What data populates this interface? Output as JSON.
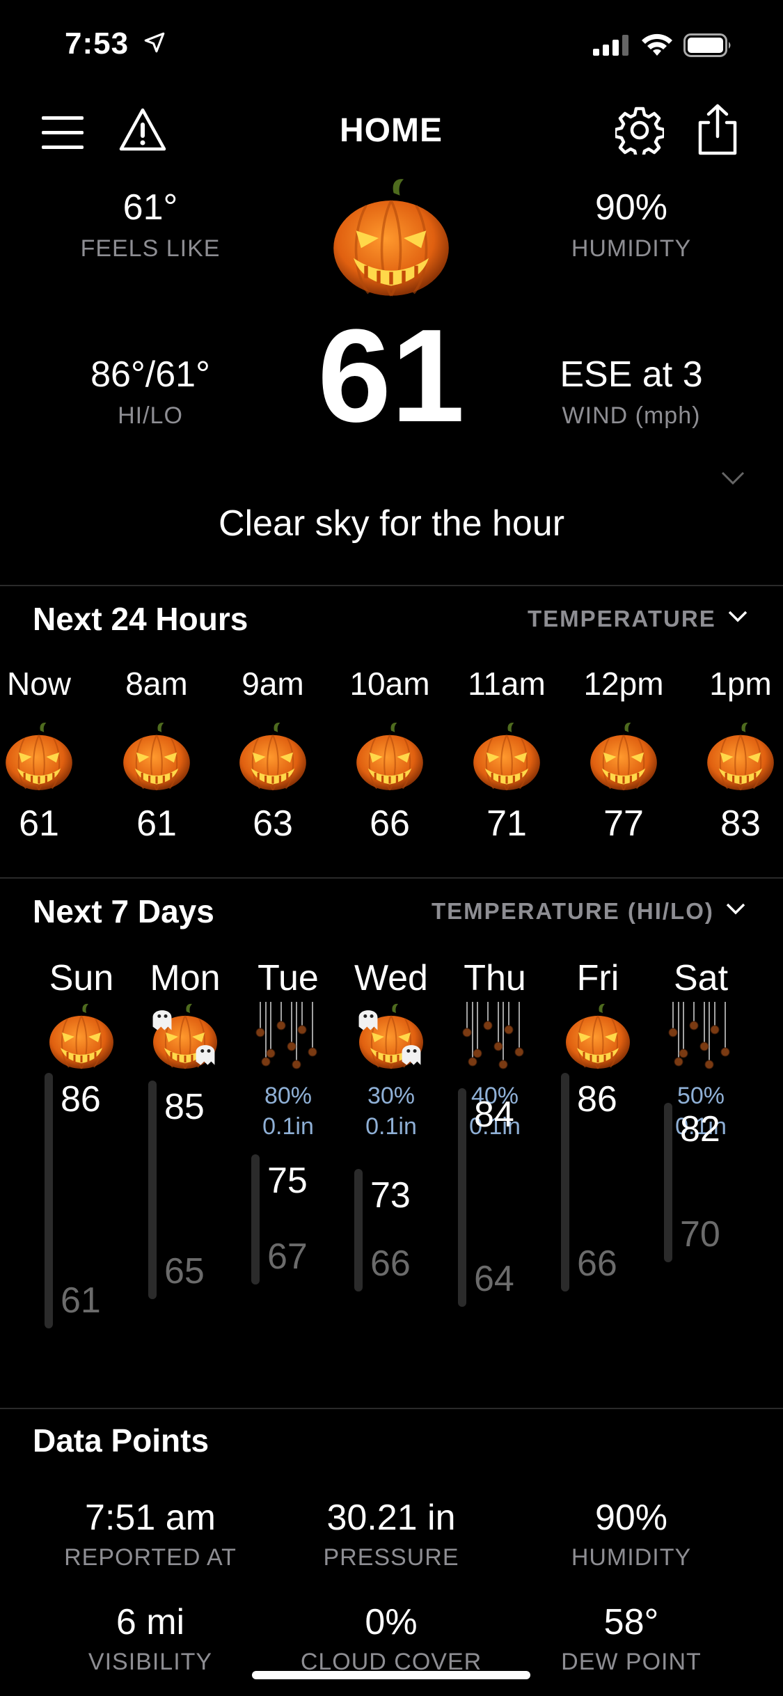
{
  "status_bar": {
    "time": "7:53"
  },
  "header": {
    "title": "HOME"
  },
  "current": {
    "feels_like": "61°",
    "feels_like_label": "FEELS LIKE",
    "humidity": "90%",
    "humidity_label": "HUMIDITY",
    "hilo": "86°/61°",
    "hilo_label": "HI/LO",
    "temp": "61",
    "wind": "ESE at 3",
    "wind_label": "WIND (mph)",
    "summary": "Clear sky for the hour",
    "icon": "jack-o-lantern"
  },
  "hourly": {
    "title": "Next 24 Hours",
    "selector": "TEMPERATURE",
    "items": [
      {
        "time": "Now",
        "temp": "61",
        "icon": "jack-o-lantern"
      },
      {
        "time": "8am",
        "temp": "61",
        "icon": "jack-o-lantern"
      },
      {
        "time": "9am",
        "temp": "63",
        "icon": "jack-o-lantern"
      },
      {
        "time": "10am",
        "temp": "66",
        "icon": "jack-o-lantern"
      },
      {
        "time": "11am",
        "temp": "71",
        "icon": "jack-o-lantern"
      },
      {
        "time": "12pm",
        "temp": "77",
        "icon": "jack-o-lantern"
      },
      {
        "time": "1pm",
        "temp": "83",
        "icon": "jack-o-lantern"
      }
    ]
  },
  "daily": {
    "title": "Next 7 Days",
    "selector": "TEMPERATURE (HI/LO)",
    "items": [
      {
        "day": "Sun",
        "icon": "jack-o-lantern",
        "precip_chance": "",
        "precip_amount": "",
        "hi": "86",
        "lo": "61"
      },
      {
        "day": "Mon",
        "icon": "pumpkin-ghost",
        "precip_chance": "",
        "precip_amount": "",
        "hi": "85",
        "lo": "65"
      },
      {
        "day": "Tue",
        "icon": "hanging-spiders",
        "precip_chance": "80%",
        "precip_amount": "0.1in",
        "hi": "75",
        "lo": "67"
      },
      {
        "day": "Wed",
        "icon": "pumpkin-ghost",
        "precip_chance": "30%",
        "precip_amount": "0.1in",
        "hi": "73",
        "lo": "66"
      },
      {
        "day": "Thu",
        "icon": "hanging-spiders",
        "precip_chance": "40%",
        "precip_amount": "0.1in",
        "hi": "84",
        "lo": "64"
      },
      {
        "day": "Fri",
        "icon": "jack-o-lantern",
        "precip_chance": "",
        "precip_amount": "",
        "hi": "86",
        "lo": "66"
      },
      {
        "day": "Sat",
        "icon": "hanging-spiders",
        "precip_chance": "50%",
        "precip_amount": "0.1in",
        "hi": "82",
        "lo": "70"
      }
    ]
  },
  "data_points": {
    "title": "Data Points",
    "items": [
      {
        "value": "7:51 am",
        "label": "REPORTED AT"
      },
      {
        "value": "30.21 in",
        "label": "PRESSURE"
      },
      {
        "value": "90%",
        "label": "HUMIDITY"
      },
      {
        "value": "6 mi",
        "label": "VISIBILITY"
      },
      {
        "value": "0%",
        "label": "CLOUD COVER"
      },
      {
        "value": "58°",
        "label": "DEW POINT"
      }
    ]
  }
}
